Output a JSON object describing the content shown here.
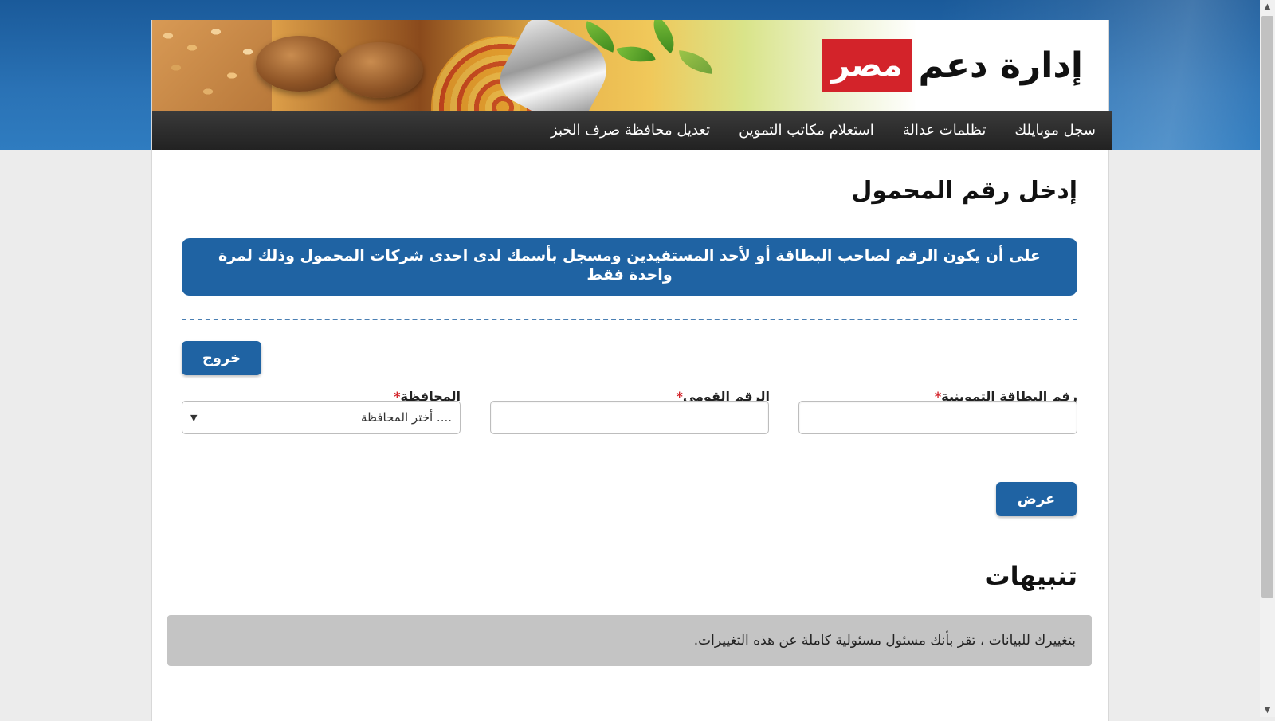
{
  "header": {
    "brand_text": "إدارة دعم",
    "brand_box": "مصر"
  },
  "nav": {
    "items": [
      {
        "label": "سجل موبايلك"
      },
      {
        "label": "تظلمات عدالة"
      },
      {
        "label": "استعلام مكاتب التموين"
      },
      {
        "label": "تعديل محافظة صرف الخبز"
      }
    ]
  },
  "main": {
    "title": "إدخل رقم المحمول",
    "notice": "على أن يكون الرقم لصاحب البطاقة أو لأحد المستفيدين ومسجل بأسمك لدى احدى شركات المحمول وذلك لمرة واحدة فقط",
    "logout_label": "خروج",
    "fields": {
      "card_label": "رقم البطاقة التموينية",
      "card_value": "",
      "national_label": "الرقم القومى",
      "national_value": "",
      "governorate_label": "المحافظة",
      "governorate_selected": ".... أختر المحافظة"
    },
    "required_mark": "*",
    "show_label": "عرض"
  },
  "alerts": {
    "title": "تنبيهات",
    "text": "بتغييرك للبيانات ، تقر بأنك مسئول مسئولية كاملة عن هذه التغييرات."
  },
  "scrollbar": {
    "up_arrow": "▲",
    "down_arrow": "▼"
  }
}
